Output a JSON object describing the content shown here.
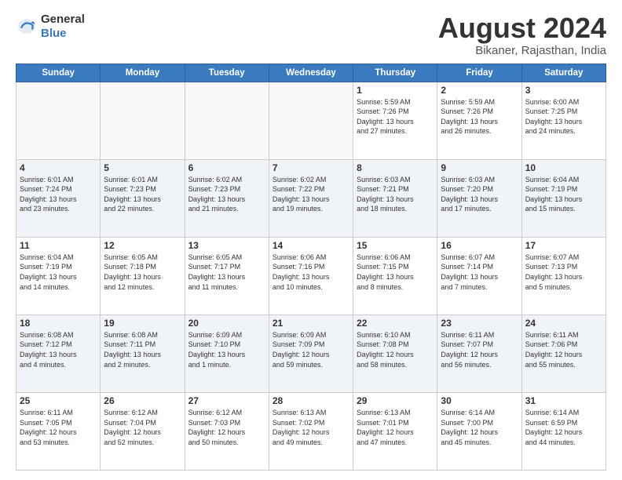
{
  "logo": {
    "text_general": "General",
    "text_blue": "Blue"
  },
  "title": {
    "month_year": "August 2024",
    "location": "Bikaner, Rajasthan, India"
  },
  "days_header": [
    "Sunday",
    "Monday",
    "Tuesday",
    "Wednesday",
    "Thursday",
    "Friday",
    "Saturday"
  ],
  "weeks": [
    [
      {
        "day": "",
        "info": ""
      },
      {
        "day": "",
        "info": ""
      },
      {
        "day": "",
        "info": ""
      },
      {
        "day": "",
        "info": ""
      },
      {
        "day": "1",
        "info": "Sunrise: 5:59 AM\nSunset: 7:26 PM\nDaylight: 13 hours\nand 27 minutes."
      },
      {
        "day": "2",
        "info": "Sunrise: 5:59 AM\nSunset: 7:26 PM\nDaylight: 13 hours\nand 26 minutes."
      },
      {
        "day": "3",
        "info": "Sunrise: 6:00 AM\nSunset: 7:25 PM\nDaylight: 13 hours\nand 24 minutes."
      }
    ],
    [
      {
        "day": "4",
        "info": "Sunrise: 6:01 AM\nSunset: 7:24 PM\nDaylight: 13 hours\nand 23 minutes."
      },
      {
        "day": "5",
        "info": "Sunrise: 6:01 AM\nSunset: 7:23 PM\nDaylight: 13 hours\nand 22 minutes."
      },
      {
        "day": "6",
        "info": "Sunrise: 6:02 AM\nSunset: 7:23 PM\nDaylight: 13 hours\nand 21 minutes."
      },
      {
        "day": "7",
        "info": "Sunrise: 6:02 AM\nSunset: 7:22 PM\nDaylight: 13 hours\nand 19 minutes."
      },
      {
        "day": "8",
        "info": "Sunrise: 6:03 AM\nSunset: 7:21 PM\nDaylight: 13 hours\nand 18 minutes."
      },
      {
        "day": "9",
        "info": "Sunrise: 6:03 AM\nSunset: 7:20 PM\nDaylight: 13 hours\nand 17 minutes."
      },
      {
        "day": "10",
        "info": "Sunrise: 6:04 AM\nSunset: 7:19 PM\nDaylight: 13 hours\nand 15 minutes."
      }
    ],
    [
      {
        "day": "11",
        "info": "Sunrise: 6:04 AM\nSunset: 7:19 PM\nDaylight: 13 hours\nand 14 minutes."
      },
      {
        "day": "12",
        "info": "Sunrise: 6:05 AM\nSunset: 7:18 PM\nDaylight: 13 hours\nand 12 minutes."
      },
      {
        "day": "13",
        "info": "Sunrise: 6:05 AM\nSunset: 7:17 PM\nDaylight: 13 hours\nand 11 minutes."
      },
      {
        "day": "14",
        "info": "Sunrise: 6:06 AM\nSunset: 7:16 PM\nDaylight: 13 hours\nand 10 minutes."
      },
      {
        "day": "15",
        "info": "Sunrise: 6:06 AM\nSunset: 7:15 PM\nDaylight: 13 hours\nand 8 minutes."
      },
      {
        "day": "16",
        "info": "Sunrise: 6:07 AM\nSunset: 7:14 PM\nDaylight: 13 hours\nand 7 minutes."
      },
      {
        "day": "17",
        "info": "Sunrise: 6:07 AM\nSunset: 7:13 PM\nDaylight: 13 hours\nand 5 minutes."
      }
    ],
    [
      {
        "day": "18",
        "info": "Sunrise: 6:08 AM\nSunset: 7:12 PM\nDaylight: 13 hours\nand 4 minutes."
      },
      {
        "day": "19",
        "info": "Sunrise: 6:08 AM\nSunset: 7:11 PM\nDaylight: 13 hours\nand 2 minutes."
      },
      {
        "day": "20",
        "info": "Sunrise: 6:09 AM\nSunset: 7:10 PM\nDaylight: 13 hours\nand 1 minute."
      },
      {
        "day": "21",
        "info": "Sunrise: 6:09 AM\nSunset: 7:09 PM\nDaylight: 12 hours\nand 59 minutes."
      },
      {
        "day": "22",
        "info": "Sunrise: 6:10 AM\nSunset: 7:08 PM\nDaylight: 12 hours\nand 58 minutes."
      },
      {
        "day": "23",
        "info": "Sunrise: 6:11 AM\nSunset: 7:07 PM\nDaylight: 12 hours\nand 56 minutes."
      },
      {
        "day": "24",
        "info": "Sunrise: 6:11 AM\nSunset: 7:06 PM\nDaylight: 12 hours\nand 55 minutes."
      }
    ],
    [
      {
        "day": "25",
        "info": "Sunrise: 6:11 AM\nSunset: 7:05 PM\nDaylight: 12 hours\nand 53 minutes."
      },
      {
        "day": "26",
        "info": "Sunrise: 6:12 AM\nSunset: 7:04 PM\nDaylight: 12 hours\nand 52 minutes."
      },
      {
        "day": "27",
        "info": "Sunrise: 6:12 AM\nSunset: 7:03 PM\nDaylight: 12 hours\nand 50 minutes."
      },
      {
        "day": "28",
        "info": "Sunrise: 6:13 AM\nSunset: 7:02 PM\nDaylight: 12 hours\nand 49 minutes."
      },
      {
        "day": "29",
        "info": "Sunrise: 6:13 AM\nSunset: 7:01 PM\nDaylight: 12 hours\nand 47 minutes."
      },
      {
        "day": "30",
        "info": "Sunrise: 6:14 AM\nSunset: 7:00 PM\nDaylight: 12 hours\nand 45 minutes."
      },
      {
        "day": "31",
        "info": "Sunrise: 6:14 AM\nSunset: 6:59 PM\nDaylight: 12 hours\nand 44 minutes."
      }
    ]
  ]
}
